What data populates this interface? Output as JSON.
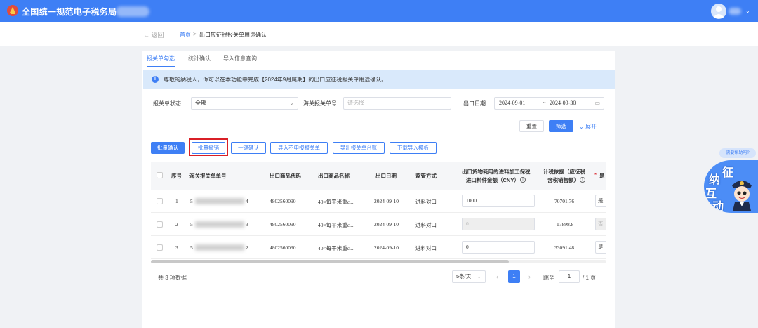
{
  "header": {
    "title": "全国统一规范电子税务局"
  },
  "breadcrumb": {
    "back": "← 返回",
    "home": "首页",
    "separator": ">",
    "current": "出口应征税报关单用途确认"
  },
  "tabs": [
    {
      "label": "报关单勾选",
      "active": true
    },
    {
      "label": "统计确认",
      "active": false
    },
    {
      "label": "导入信息查询",
      "active": false
    }
  ],
  "notice": {
    "text": "尊敬的纳税人，你可以在本功能中完成【2024年9月属期】的出口应征税报关单用途确认。"
  },
  "filters": {
    "status_label": "报关单状态",
    "status_value": "全部",
    "customs_no_label": "海关报关单号",
    "customs_no_placeholder": "请选择",
    "date_label": "出口日期",
    "date_start": "2024-09-01",
    "date_sep": "~",
    "date_end": "2024-09-30"
  },
  "filter_actions": {
    "reset": "重置",
    "filter": "筛选",
    "expand": "展开"
  },
  "toolbar": {
    "batch_confirm": "批量确认",
    "batch_revoke": "批量撤销",
    "one_click_confirm": "一键确认",
    "import_non_declare": "导入不申报报关单",
    "export_ledger": "导出报关单台账",
    "download_template": "下载导入模板"
  },
  "table": {
    "headers": {
      "seq": "序号",
      "customs_no": "海关报关单单号",
      "goods_code": "出口商品代码",
      "goods_name": "出口商品名称",
      "export_date": "出口日期",
      "supervision": "监管方式",
      "import_amount_1": "出口货物耗用的进料加工保税",
      "import_amount_2": "进口料件金额（CNY）",
      "tax_basis_1": "计税依据（应征税",
      "tax_basis_2": "含税销售额）",
      "is_col": "是"
    },
    "rows": [
      {
        "seq": "1",
        "id_prefix": "5",
        "id_suffix": "4",
        "goods_code": "4802560090",
        "goods_name": "40<每平米重c...",
        "export_date": "2024-09-10",
        "supervision": "进料对口",
        "amount": "1000",
        "amount_disabled": false,
        "tax_basis": "70701.76",
        "yes": "是",
        "yes_disabled": false
      },
      {
        "seq": "2",
        "id_prefix": "5",
        "id_suffix": "3",
        "goods_code": "4802560090",
        "goods_name": "40<每平米重c...",
        "export_date": "2024-09-10",
        "supervision": "进料对口",
        "amount": "0",
        "amount_disabled": true,
        "tax_basis": "17898.8",
        "yes": "否",
        "yes_disabled": true
      },
      {
        "seq": "3",
        "id_prefix": "5",
        "id_suffix": "2",
        "goods_code": "4802560090",
        "goods_name": "40<每平米重c...",
        "export_date": "2024-09-10",
        "supervision": "进料对口",
        "amount": "0",
        "amount_disabled": false,
        "tax_basis": "33091.48",
        "yes": "是",
        "yes_disabled": false
      }
    ]
  },
  "pagination": {
    "total": "共 3 项数据",
    "page_size": "5条/页",
    "current_page": "1",
    "jump_label": "跳至",
    "jump_value": "1",
    "total_pages": "/ 1 页"
  },
  "assistant": {
    "help_text": "需要帮助吗?",
    "chars": [
      "征",
      "纳",
      "互",
      "动"
    ]
  },
  "colors": {
    "brand": "#3e7ff5",
    "highlight": "#d91f26"
  }
}
